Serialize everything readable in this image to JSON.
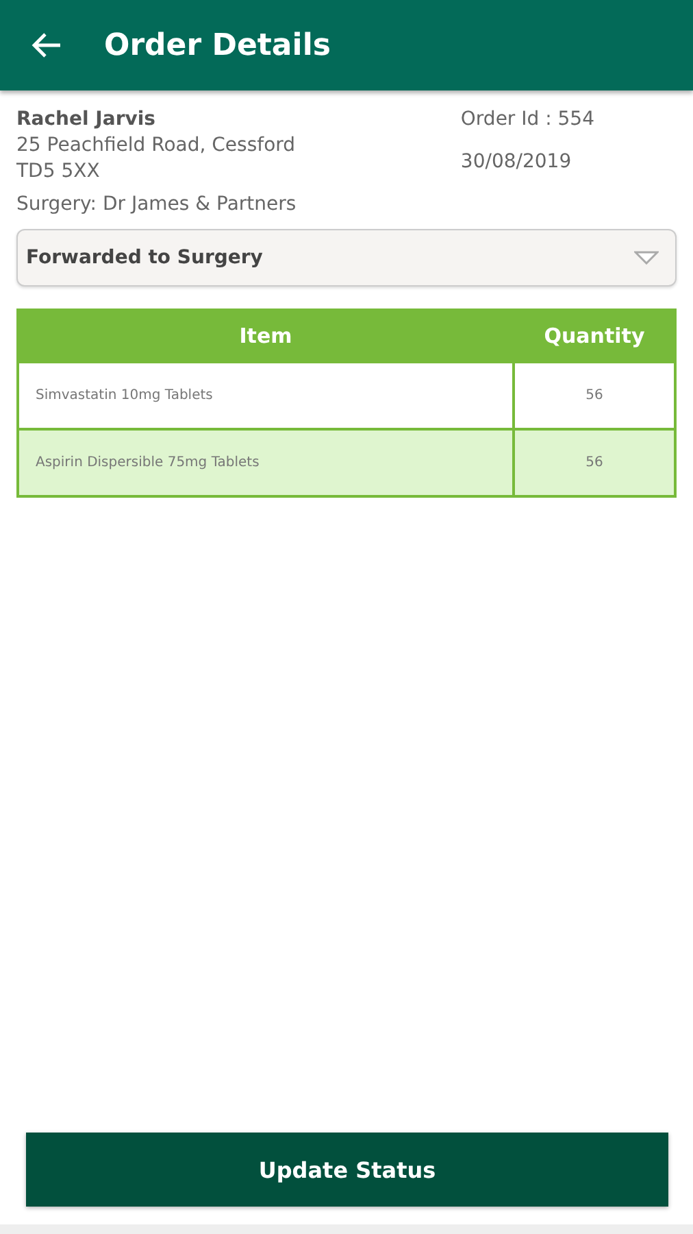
{
  "app_bar": {
    "title": "Order Details"
  },
  "customer": {
    "name": "Rachel Jarvis",
    "address_lines": [
      "25 Peachfield Road, Cessford",
      "TD5 5XX"
    ],
    "surgery": "Surgery: Dr James & Partners"
  },
  "order": {
    "id": "Order Id : 554",
    "date": "30/08/2019"
  },
  "status_dropdown": {
    "value": "Forwarded to Surgery"
  },
  "table": {
    "columns": [
      "Item",
      "Quantity"
    ],
    "rows": [
      [
        "Simvastatin 10mg Tablets",
        "56"
      ],
      [
        "Aspirin Dispersible 75mg Tablets",
        "56"
      ]
    ]
  },
  "update_button": {
    "label": "Update Status"
  }
}
